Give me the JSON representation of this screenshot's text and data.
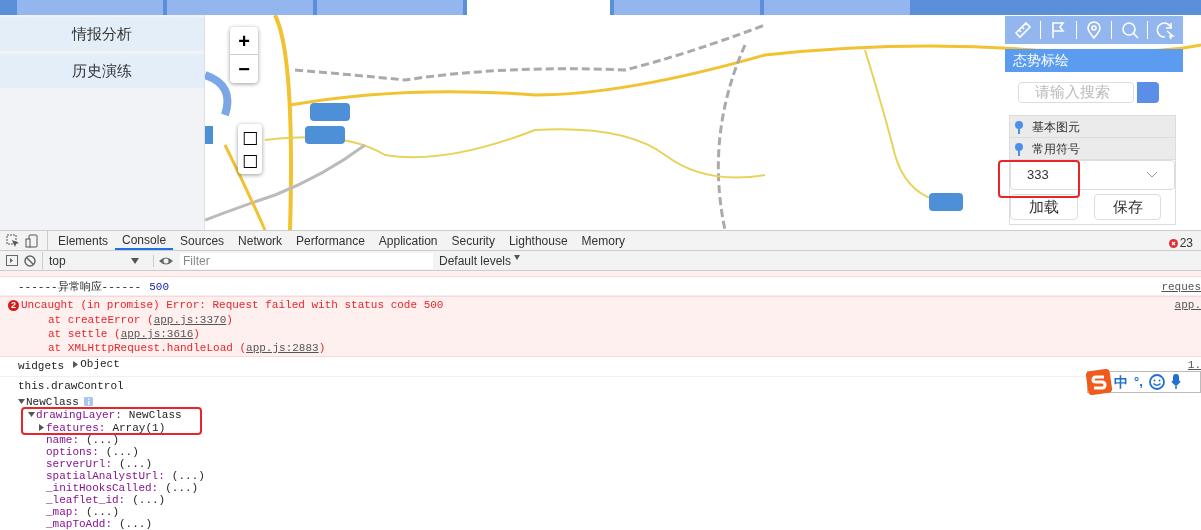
{
  "nav_tabs": [
    {
      "selected": false
    },
    {
      "selected": false
    },
    {
      "selected": false
    },
    {
      "selected": true
    },
    {
      "selected": false
    },
    {
      "selected": false
    }
  ],
  "sidebar": {
    "items": [
      {
        "label": "情报分析"
      },
      {
        "label": "历史演练"
      }
    ]
  },
  "map": {
    "kind": "picture",
    "zoom_in": "+",
    "zoom_out": "−",
    "extra_controls": [
      "□",
      "□"
    ]
  },
  "panel": {
    "title": "态势标绘",
    "search": {
      "placeholder": "请输入搜索"
    },
    "layers": [
      {
        "label": "基本图元"
      },
      {
        "label": "常用符号"
      }
    ],
    "select": {
      "value": "333"
    },
    "buttons": [
      "加载",
      "保存"
    ]
  },
  "devtools": {
    "tabs": [
      {
        "label": "Elements",
        "selected": false
      },
      {
        "label": "Console",
        "selected": true
      },
      {
        "label": "Sources",
        "selected": false
      },
      {
        "label": "Network",
        "selected": false
      },
      {
        "label": "Performance",
        "selected": false
      },
      {
        "label": "Application",
        "selected": false
      },
      {
        "label": "Security",
        "selected": false
      },
      {
        "label": "Lighthouse",
        "selected": false
      },
      {
        "label": "Memory",
        "selected": false
      }
    ],
    "error_count": "23",
    "context": "top",
    "filter": {
      "placeholder": "Filter"
    },
    "levels": "Default levels",
    "messages": [
      {
        "kind": "log",
        "text": "------异常响应------",
        "value": "500",
        "source": "reques"
      },
      {
        "kind": "error",
        "count": "2",
        "text": "Uncaught (in promise) Error: Request failed with status code 500",
        "stack": [
          {
            "before": "at createError (",
            "link": "app.js:3370",
            "after": ")"
          },
          {
            "before": "at settle (",
            "link": "app.js:3616",
            "after": ")"
          },
          {
            "before": "at XMLHttpRequest.handleLoad (",
            "link": "app.js:2883",
            "after": ")"
          }
        ],
        "source": "app."
      },
      {
        "kind": "object",
        "label": "widgets",
        "value": "Object",
        "expanded": false,
        "source": "1."
      },
      {
        "kind": "tree",
        "label": "this.drawControl",
        "root": {
          "key": "NewClass",
          "info": true,
          "expanded": true,
          "children": [
            {
              "key": "drawingLayer:",
              "value": "NewClass",
              "expanded": true,
              "children": [
                {
                  "key": "features:",
                  "value": "Array(1)",
                  "expanded": false
                },
                {
                  "key": "name:",
                  "value": "(...)"
                },
                {
                  "key": "options:",
                  "value": "(...)"
                },
                {
                  "key": "serverUrl:",
                  "value": "(...)"
                },
                {
                  "key": "spatialAnalystUrl:",
                  "value": "(...)"
                },
                {
                  "key": "_initHooksCalled:",
                  "value": "(...)"
                },
                {
                  "key": "_leaflet_id:",
                  "value": "(...)"
                },
                {
                  "key": "_map:",
                  "value": "(...)"
                },
                {
                  "key": "_mapToAdd:",
                  "value": "(...)"
                }
              ]
            }
          ]
        }
      }
    ]
  },
  "ime_toolbar": {
    "mode": "中",
    "punctuation": "°,"
  }
}
